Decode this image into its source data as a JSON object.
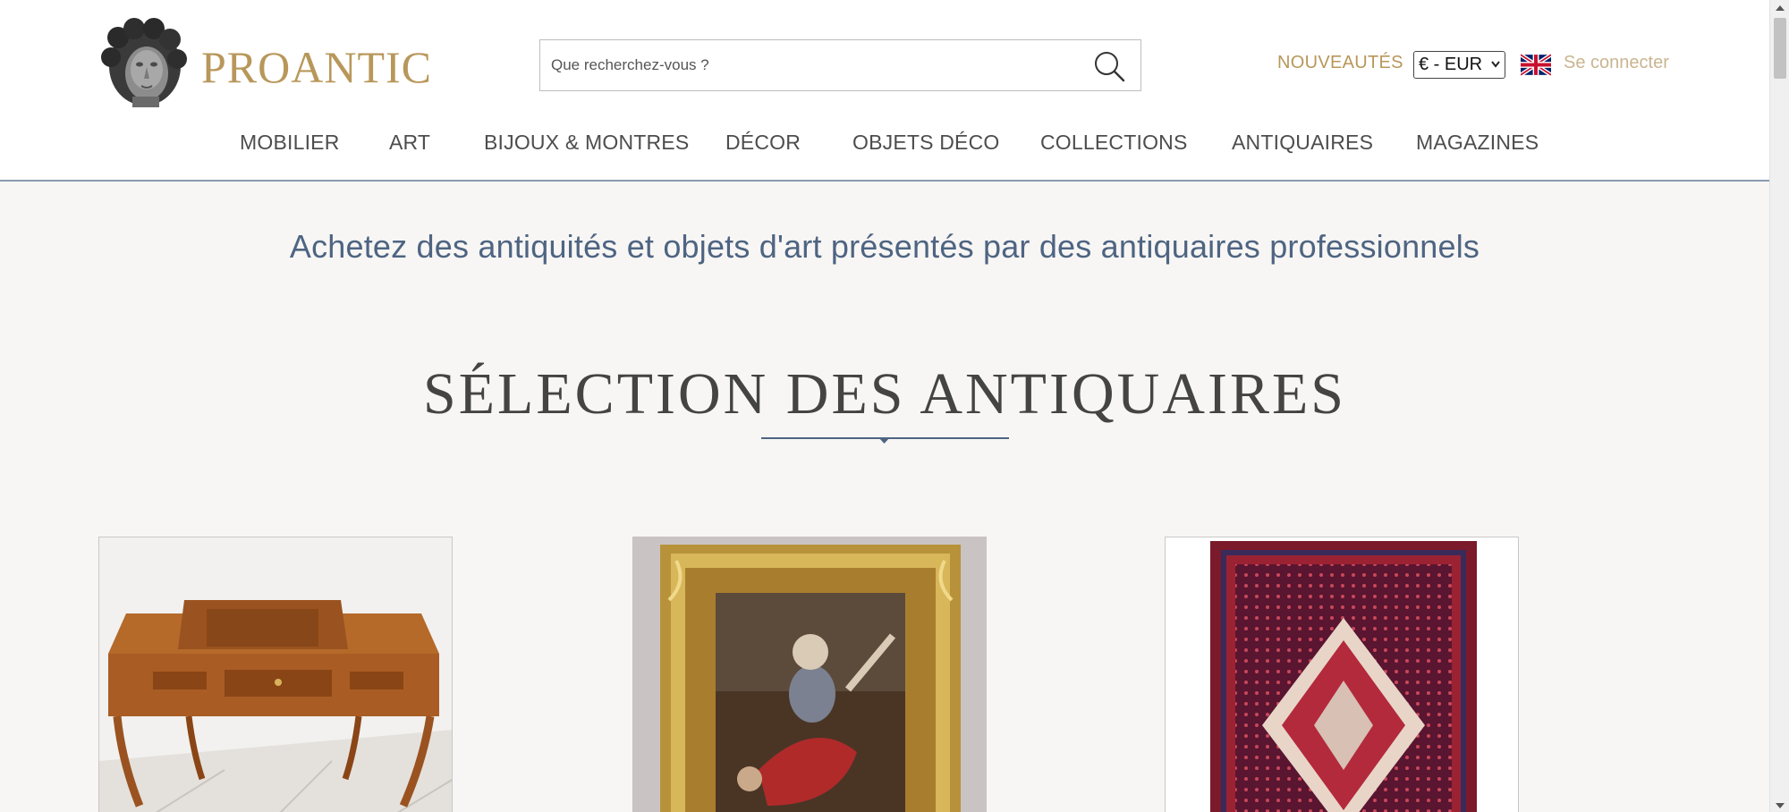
{
  "brand": {
    "name": "PROANTIC"
  },
  "search": {
    "placeholder": "Que recherchez-vous ?"
  },
  "header": {
    "nouveautes": "NOUVEAUTÉS",
    "currency": "€ - EUR",
    "login": "Se connecter"
  },
  "nav": [
    "MOBILIER",
    "ART",
    "BIJOUX & MONTRES",
    "DÉCOR",
    "OBJETS DÉCO",
    "COLLECTIONS",
    "ANTIQUAIRES",
    "MAGAZINES"
  ],
  "main": {
    "tagline": "Achetez des antiquités et objets d'art présentés par des antiquaires professionnels",
    "section_title": "SÉLECTION DES ANTIQUAIRES"
  },
  "icons": {
    "search": "search-icon",
    "flag": "uk-flag-icon",
    "logo": "sculpted-head-logo"
  },
  "colors": {
    "gold": "#b8975a",
    "navy": "#4e6482",
    "background": "#f7f6f4"
  }
}
